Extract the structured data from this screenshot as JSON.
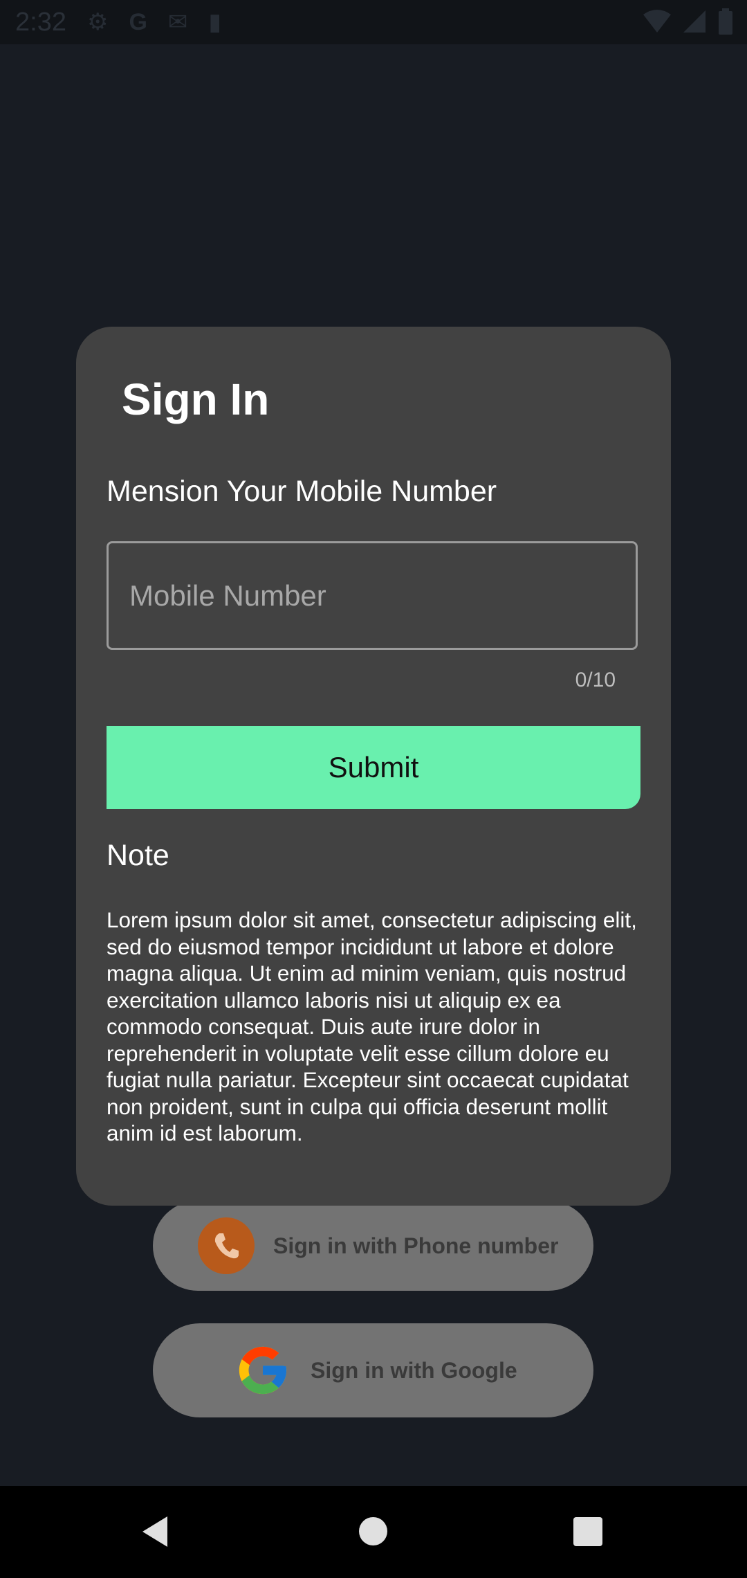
{
  "status_bar": {
    "time": "2:32",
    "left_icons": [
      "gear-icon",
      "google-g-icon",
      "gmail-icon",
      "sd-card-icon"
    ],
    "right_icons": [
      "wifi-icon",
      "signal-icon",
      "battery-icon"
    ]
  },
  "background_buttons": {
    "phone_label": "Sign in with Phone number",
    "google_label": "Sign in with Google"
  },
  "dialog": {
    "title": "Sign In",
    "subtitle": "Mension Your Mobile Number",
    "input_placeholder": "Mobile Number",
    "input_value": "",
    "char_counter": "0/10",
    "submit_label": "Submit",
    "note_heading": "Note",
    "note_body": "Lorem ipsum dolor sit amet, consectetur adipiscing elit, sed do eiusmod tempor incididunt ut labore et dolore magna aliqua. Ut enim ad minim veniam, quis nostrud exercitation ullamco laboris nisi ut aliquip ex ea commodo consequat. Duis aute irure dolor in reprehenderit in voluptate velit esse cillum dolore eu fugiat nulla pariatur. Excepteur sint occaecat cupidatat non proident, sunt in culpa qui officia deserunt mollit anim id est laborum."
  },
  "colors": {
    "accent": "#69f0ae",
    "dialog_background": "#424242",
    "app_background": "#181c23",
    "phone_icon_background": "#b85a1b"
  },
  "nav_bar": {
    "buttons": [
      "back-icon",
      "home-icon",
      "recents-icon"
    ]
  }
}
